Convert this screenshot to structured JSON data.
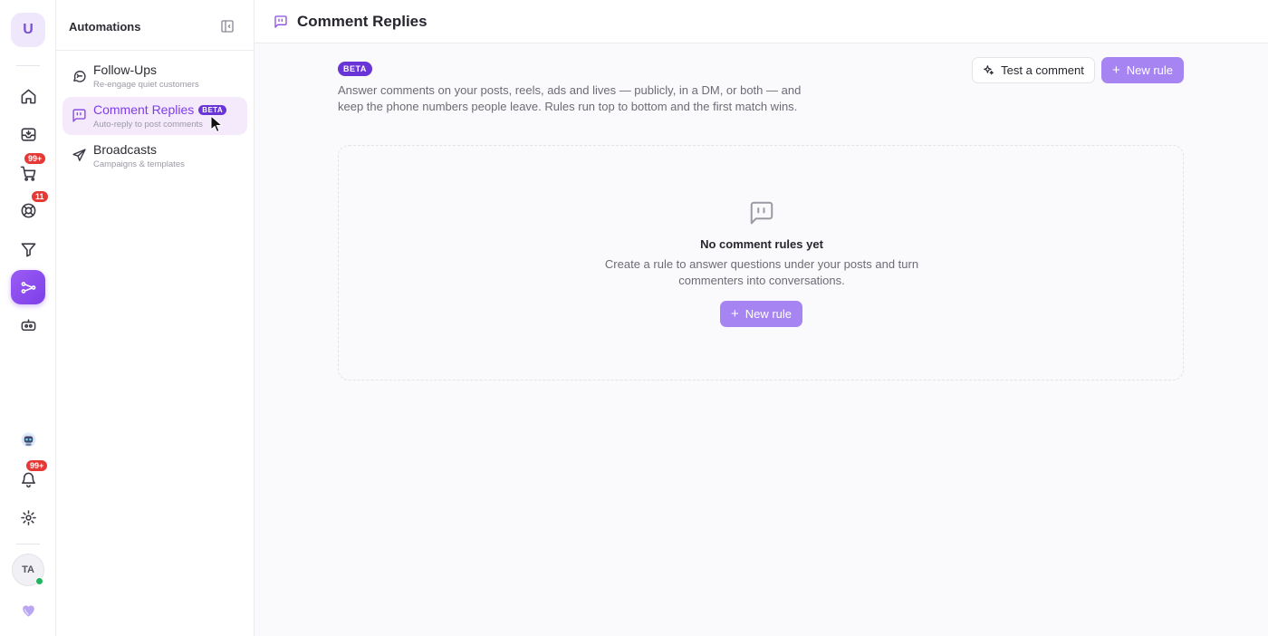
{
  "rail": {
    "workspace_initial": "U",
    "cart_badge": "99+",
    "support_badge": "11",
    "notifications_badge": "99+",
    "user_initials": "TA"
  },
  "sidebar": {
    "title": "Automations",
    "items": [
      {
        "label": "Follow-Ups",
        "subtitle": "Re-engage quiet customers",
        "icon": "message-circle-icon",
        "active": false
      },
      {
        "label": "Comment Replies",
        "badge": "BETA",
        "subtitle": "Auto-reply to post comments",
        "icon": "message-square-quote-icon",
        "active": true
      },
      {
        "label": "Broadcasts",
        "subtitle": "Campaigns & templates",
        "icon": "send-icon",
        "active": false
      }
    ]
  },
  "header": {
    "title": "Comment Replies"
  },
  "main": {
    "beta_label": "BETA",
    "description": "Answer comments on your posts, reels, ads and lives — publicly, in a DM, or both — and keep the phone numbers people leave. Rules run top to bottom and the first match wins.",
    "test_button_label": "Test a comment",
    "new_rule_label": "New rule",
    "empty": {
      "title": "No comment rules yet",
      "text": "Create a rule to answer questions under your posts and turn commenters into conversations.",
      "button_label": "New rule"
    }
  },
  "colors": {
    "accent": "#7d3ee8",
    "button_primary": "#a685f2",
    "badge_beta": "#6a35d6",
    "badge_alert": "#e53935",
    "active_nav_bg": "#f5e9fc",
    "online": "#22b35e"
  }
}
